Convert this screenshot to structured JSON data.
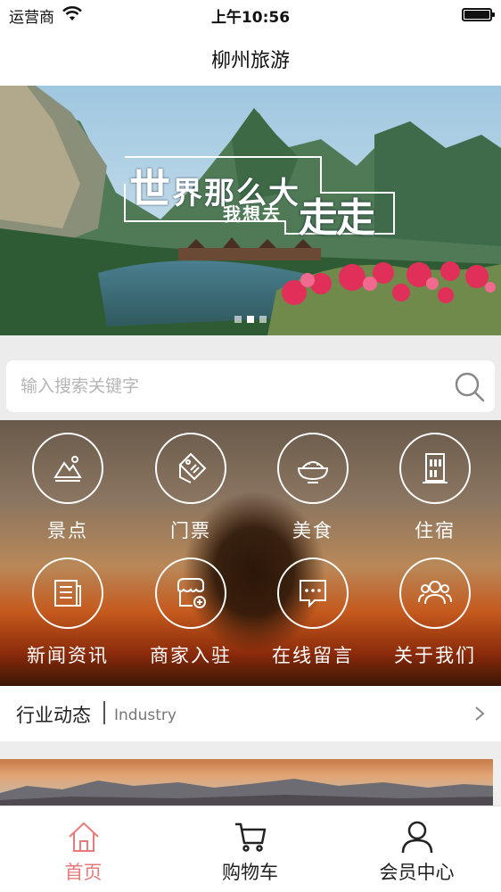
{
  "status_bar": {
    "carrier": "运营商",
    "time": "上午10:56"
  },
  "nav": {
    "title": "柳州旅游"
  },
  "banner": {
    "slogan_line1_big": "世",
    "slogan_line1_rest": "界那么大",
    "slogan_line2": "我想去",
    "slogan_line3": "走走",
    "dots": 3,
    "active_dot": 2
  },
  "search": {
    "placeholder": "输入搜索关键字",
    "value": ""
  },
  "menu": {
    "items": [
      {
        "label": "景点",
        "icon": "landscape-icon"
      },
      {
        "label": "门票",
        "icon": "ticket-icon"
      },
      {
        "label": "美食",
        "icon": "food-bowl-icon"
      },
      {
        "label": "住宿",
        "icon": "building-icon"
      },
      {
        "label": "新闻资讯",
        "icon": "newspaper-icon"
      },
      {
        "label": "商家入驻",
        "icon": "shop-add-icon"
      },
      {
        "label": "在线留言",
        "icon": "chat-bubble-icon"
      },
      {
        "label": "关于我们",
        "icon": "group-icon"
      }
    ]
  },
  "industry": {
    "title": "行业动态",
    "subtitle": "Industry"
  },
  "tabs": [
    {
      "label": "首页",
      "icon": "home-icon",
      "active": true
    },
    {
      "label": "购物车",
      "icon": "cart-icon",
      "active": false
    },
    {
      "label": "会员中心",
      "icon": "user-icon",
      "active": false
    }
  ],
  "colors": {
    "accent": "#e87a7a",
    "tab_inactive": "#222222"
  }
}
